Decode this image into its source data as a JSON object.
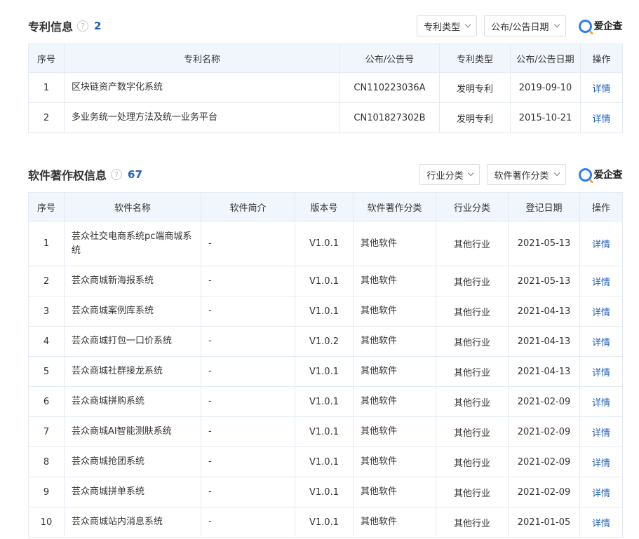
{
  "patent": {
    "title": "专利信息",
    "count": "2",
    "filters": [
      "专利类型",
      "公布/公告日期"
    ],
    "brand": "爱企查",
    "columns": [
      "序号",
      "专利名称",
      "公布/公告号",
      "专利类型",
      "公布/公告日期",
      "操作"
    ],
    "rows": [
      {
        "idx": "1",
        "name": "区块链资产数字化系统",
        "number": "CN110223036A",
        "type": "发明专利",
        "date": "2019-09-10",
        "action": "详情"
      },
      {
        "idx": "2",
        "name": "多业务统一处理方法及统一业务平台",
        "number": "CN101827302B",
        "type": "发明专利",
        "date": "2015-10-21",
        "action": "详情"
      }
    ]
  },
  "software": {
    "title": "软件著作权信息",
    "count": "67",
    "filters": [
      "行业分类",
      "软件著作分类"
    ],
    "brand": "爱企查",
    "columns": [
      "序号",
      "软件名称",
      "软件简介",
      "版本号",
      "软件著作分类",
      "行业分类",
      "登记日期",
      "操作"
    ],
    "rows": [
      {
        "idx": "1",
        "name": "芸众社交电商系统pc端商城系统",
        "intro": "-",
        "version": "V1.0.1",
        "category": "其他软件",
        "industry": "其他行业",
        "date": "2021-05-13",
        "action": "详情"
      },
      {
        "idx": "2",
        "name": "芸众商城新海报系统",
        "intro": "-",
        "version": "V1.0.1",
        "category": "其他软件",
        "industry": "其他行业",
        "date": "2021-05-13",
        "action": "详情"
      },
      {
        "idx": "3",
        "name": "芸众商城案例库系统",
        "intro": "-",
        "version": "V1.0.1",
        "category": "其他软件",
        "industry": "其他行业",
        "date": "2021-04-13",
        "action": "详情"
      },
      {
        "idx": "4",
        "name": "芸众商城打包一口价系统",
        "intro": "-",
        "version": "V1.0.2",
        "category": "其他软件",
        "industry": "其他行业",
        "date": "2021-04-13",
        "action": "详情"
      },
      {
        "idx": "5",
        "name": "芸众商城社群接龙系统",
        "intro": "-",
        "version": "V1.0.1",
        "category": "其他软件",
        "industry": "其他行业",
        "date": "2021-04-13",
        "action": "详情"
      },
      {
        "idx": "6",
        "name": "芸众商城拼购系统",
        "intro": "-",
        "version": "V1.0.1",
        "category": "其他软件",
        "industry": "其他行业",
        "date": "2021-02-09",
        "action": "详情"
      },
      {
        "idx": "7",
        "name": "芸众商城AI智能测肤系统",
        "intro": "-",
        "version": "V1.0.1",
        "category": "其他软件",
        "industry": "其他行业",
        "date": "2021-02-09",
        "action": "详情"
      },
      {
        "idx": "8",
        "name": "芸众商城抢团系统",
        "intro": "-",
        "version": "V1.0.1",
        "category": "其他软件",
        "industry": "其他行业",
        "date": "2021-02-09",
        "action": "详情"
      },
      {
        "idx": "9",
        "name": "芸众商城拼单系统",
        "intro": "-",
        "version": "V1.0.1",
        "category": "其他软件",
        "industry": "其他行业",
        "date": "2021-02-09",
        "action": "详情"
      },
      {
        "idx": "10",
        "name": "芸众商城站内消息系统",
        "intro": "-",
        "version": "V1.0.1",
        "category": "其他软件",
        "industry": "其他行业",
        "date": "2021-01-05",
        "action": "详情"
      }
    ]
  },
  "colors": {
    "accent": "#1f5fb8",
    "header_bg": "#f1f6fd",
    "border": "#e4eaf2"
  },
  "icons": {
    "help": "question-circle-icon",
    "brand": "aiqicha-logo-icon",
    "dropdown": "chevron-down-icon"
  }
}
